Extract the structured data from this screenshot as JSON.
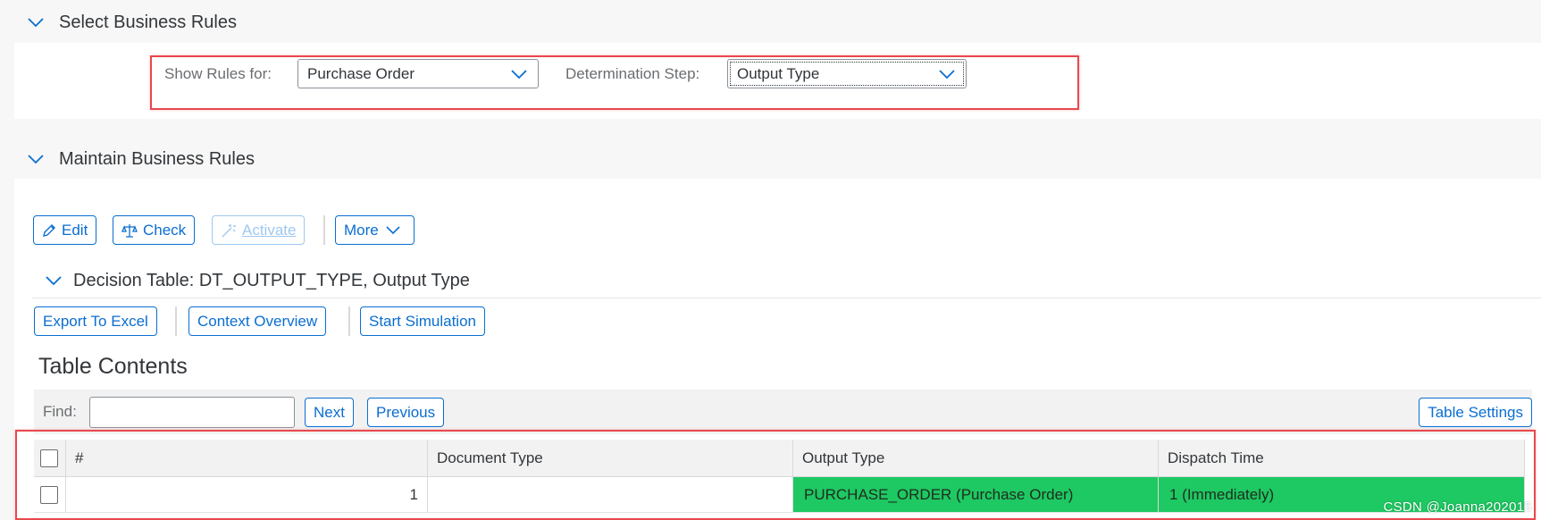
{
  "sections": {
    "select": {
      "title": "Select Business Rules"
    },
    "maintain": {
      "title": "Maintain Business Rules"
    }
  },
  "filters": {
    "show_rules_label": "Show Rules for:",
    "show_rules_value": "Purchase Order",
    "determination_label": "Determination Step:",
    "determination_value": "Output Type"
  },
  "toolbar": {
    "edit": "Edit",
    "check": "Check",
    "activate": "Activate",
    "more": "More"
  },
  "decision_table": {
    "title": "Decision Table: DT_OUTPUT_TYPE, Output Type",
    "export": "Export To Excel",
    "context": "Context Overview",
    "simulation": "Start Simulation"
  },
  "table": {
    "title": "Table Contents",
    "find_label": "Find:",
    "find_value": "",
    "next": "Next",
    "previous": "Previous",
    "settings": "Table Settings",
    "columns": [
      "#",
      "Document Type",
      "Output Type",
      "Dispatch Time"
    ],
    "rows": [
      {
        "num": "1",
        "document_type": "",
        "output_type": "PURCHASE_ORDER (Purchase Order)",
        "dispatch_time": "1 (Immediately)"
      }
    ]
  },
  "watermark": "CSDN @Joanna202015",
  "colors": {
    "accent": "#0a6ed1",
    "highlight": "#1ec862",
    "callout": "#e8484d"
  }
}
